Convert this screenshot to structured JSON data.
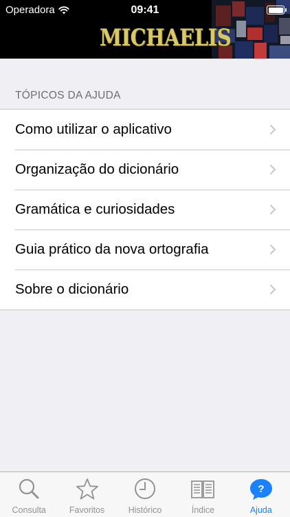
{
  "status_bar": {
    "carrier": "Operadora",
    "time": "09:41"
  },
  "header": {
    "logo_text": "MICHAELIS"
  },
  "help": {
    "section_title": "TÓPICOS DA AJUDA",
    "items": [
      {
        "label": "Como utilizar o aplicativo"
      },
      {
        "label": "Organização do dicionário"
      },
      {
        "label": "Gramática e curiosidades"
      },
      {
        "label": "Guia prático da nova ortografia"
      },
      {
        "label": "Sobre o dicionário"
      }
    ]
  },
  "tab_bar": {
    "tabs": [
      {
        "label": "Consulta",
        "icon": "search-icon"
      },
      {
        "label": "Favoritos",
        "icon": "star-icon"
      },
      {
        "label": "Histórico",
        "icon": "clock-icon"
      },
      {
        "label": "Índice",
        "icon": "book-icon"
      },
      {
        "label": "Ajuda",
        "icon": "help-icon",
        "active": true
      }
    ]
  },
  "colors": {
    "accent": "#1a82ff",
    "inactive_tab": "#929292",
    "background": "#efeff4"
  }
}
